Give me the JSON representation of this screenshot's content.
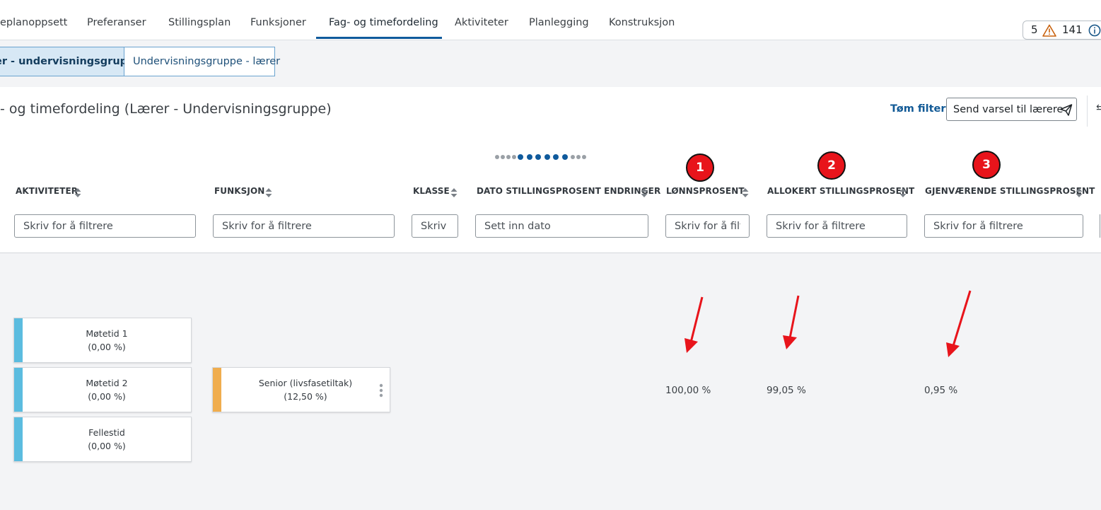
{
  "nav": {
    "tabs": [
      {
        "label": "eplanoppsett"
      },
      {
        "label": "Preferanser"
      },
      {
        "label": "Stillingsplan"
      },
      {
        "label": "Funksjoner"
      },
      {
        "label": "Fag- og timefordeling"
      },
      {
        "label": "Aktiviteter"
      },
      {
        "label": "Planlegging"
      },
      {
        "label": "Konstruksjon"
      }
    ],
    "active_tab": "Fag- og timefordeling",
    "warning_count": "5",
    "info_count": "141"
  },
  "subtabs": {
    "active": "er - undervisningsgruppe",
    "inactive": "Undervisningsgruppe - lærer"
  },
  "header": {
    "title": "- og timefordeling (Lærer - Undervisningsgruppe)",
    "clear_filter": "Tøm filter",
    "send_button": "Send varsel til lærere"
  },
  "columns": [
    {
      "label": "AKTIVITETER",
      "placeholder": "Skriv for å filtrere"
    },
    {
      "label": "FUNKSJON",
      "placeholder": "Skriv for å filtrere"
    },
    {
      "label": "KLASSE",
      "placeholder": "Skriv for å filtrere"
    },
    {
      "label": "DATO STILLINGSPROSENT ENDRINGER",
      "placeholder": "Sett inn dato"
    },
    {
      "label": "LØNNSPROSENT",
      "placeholder": "Skriv for å filtrere"
    },
    {
      "label": "ALLOKERT STILLINGSPROSENT",
      "placeholder": "Skriv for å filtrere"
    },
    {
      "label": "GJENVÆRENDE STILLINGSPROSENT",
      "placeholder": "Skriv for å filtrere"
    }
  ],
  "pagination": {
    "total": 13,
    "active_from": 5,
    "active_to": 10
  },
  "activities": [
    {
      "name": "Møtetid 1",
      "percent": "(0,00 %)"
    },
    {
      "name": "Møtetid 2",
      "percent": "(0,00 %)"
    },
    {
      "name": "Fellestid",
      "percent": "(0,00 %)"
    }
  ],
  "function": {
    "name": "Senior (livsfasetiltak)",
    "percent": "(12,50 %)"
  },
  "values": {
    "lonnsprosent": "100,00 %",
    "allokert": "99,05 %",
    "gjenvaerende": "0,95 %"
  },
  "annotations": {
    "badges": [
      "1",
      "2",
      "3"
    ]
  },
  "colors": {
    "accent": "#0f5a9c",
    "activity_stripe": "#5bbcdf",
    "function_stripe": "#f0ad4e",
    "badge": "#e8141b",
    "arrow": "#e8141b"
  }
}
